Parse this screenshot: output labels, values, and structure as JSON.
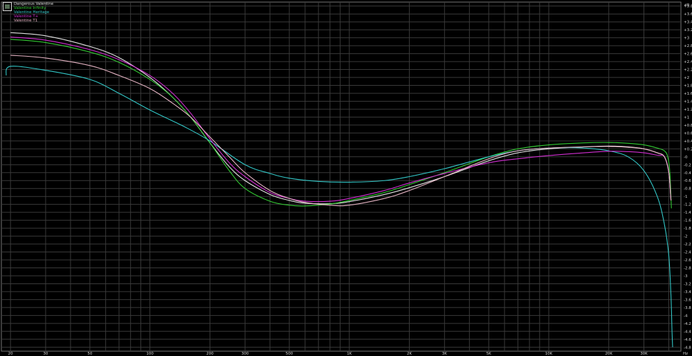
{
  "chart_data": {
    "type": "line",
    "title": "",
    "xlabel": "Hz",
    "ylabel": "dB",
    "x_scale": "log",
    "xlim": [
      18,
      46000
    ],
    "ylim": [
      -4.9,
      3.9
    ],
    "grid": true,
    "legend_position": "top-left",
    "x_tick_labels": [
      {
        "value": 20,
        "label": "20"
      },
      {
        "value": 30,
        "label": "30"
      },
      {
        "value": 50,
        "label": "50"
      },
      {
        "value": 100,
        "label": "100"
      },
      {
        "value": 200,
        "label": "200"
      },
      {
        "value": 300,
        "label": "300"
      },
      {
        "value": 500,
        "label": "500"
      },
      {
        "value": 1000,
        "label": "1K"
      },
      {
        "value": 2000,
        "label": "2K"
      },
      {
        "value": 3000,
        "label": "3K"
      },
      {
        "value": 5000,
        "label": "5K"
      },
      {
        "value": 10000,
        "label": "10K"
      },
      {
        "value": 20000,
        "label": "20K"
      },
      {
        "value": 30000,
        "label": "30K"
      }
    ],
    "y_tick_labels": [
      {
        "value": 3.8,
        "label": "+3.8"
      },
      {
        "value": 3.6,
        "label": "+3.6"
      },
      {
        "value": 3.4,
        "label": "+3.4"
      },
      {
        "value": 3.2,
        "label": "+3.2"
      },
      {
        "value": 3.0,
        "label": "+3"
      },
      {
        "value": 2.8,
        "label": "+2.8"
      },
      {
        "value": 2.6,
        "label": "+2.6"
      },
      {
        "value": 2.4,
        "label": "+2.4"
      },
      {
        "value": 2.2,
        "label": "+2.2"
      },
      {
        "value": 2.0,
        "label": "+2"
      },
      {
        "value": 1.8,
        "label": "+1.8"
      },
      {
        "value": 1.6,
        "label": "+1.6"
      },
      {
        "value": 1.4,
        "label": "+1.4"
      },
      {
        "value": 1.2,
        "label": "+1.2"
      },
      {
        "value": 1.0,
        "label": "+1"
      },
      {
        "value": 0.8,
        "label": "+0.8"
      },
      {
        "value": 0.6,
        "label": "+0.6"
      },
      {
        "value": 0.4,
        "label": "+0.4"
      },
      {
        "value": 0.2,
        "label": "+0.2"
      },
      {
        "value": 0.0,
        "label": "-0"
      },
      {
        "value": -0.2,
        "label": "-0.2"
      },
      {
        "value": -0.4,
        "label": "-0.4"
      },
      {
        "value": -0.6,
        "label": "-0.6"
      },
      {
        "value": -0.8,
        "label": "-0.8"
      },
      {
        "value": -1.0,
        "label": "-1"
      },
      {
        "value": -1.2,
        "label": "-1.2"
      },
      {
        "value": -1.4,
        "label": "-1.4"
      },
      {
        "value": -1.6,
        "label": "-1.6"
      },
      {
        "value": -1.8,
        "label": "-1.8"
      },
      {
        "value": -2.0,
        "label": "-2"
      },
      {
        "value": -2.2,
        "label": "-2.2"
      },
      {
        "value": -2.4,
        "label": "-2.4"
      },
      {
        "value": -2.6,
        "label": "-2.6"
      },
      {
        "value": -2.8,
        "label": "-2.8"
      },
      {
        "value": -3.0,
        "label": "-3"
      },
      {
        "value": -3.2,
        "label": "-3.2"
      },
      {
        "value": -3.4,
        "label": "-3.4"
      },
      {
        "value": -3.6,
        "label": "-3.6"
      },
      {
        "value": -3.8,
        "label": "-3.8"
      },
      {
        "value": -4.0,
        "label": "-4"
      },
      {
        "value": -4.2,
        "label": "-4.2"
      },
      {
        "value": -4.4,
        "label": "-4.4"
      },
      {
        "value": -4.6,
        "label": "-4.6"
      },
      {
        "value": -4.8,
        "label": "-4.8"
      }
    ],
    "series": [
      {
        "name": "Dangerous Valentine",
        "color": "#e6e6e6",
        "points": [
          [
            20,
            3.13
          ],
          [
            30,
            3.05
          ],
          [
            50,
            2.78
          ],
          [
            70,
            2.5
          ],
          [
            100,
            2.0
          ],
          [
            130,
            1.5
          ],
          [
            160,
            1.0
          ],
          [
            200,
            0.35
          ],
          [
            250,
            -0.25
          ],
          [
            300,
            -0.6
          ],
          [
            400,
            -0.95
          ],
          [
            500,
            -1.1
          ],
          [
            600,
            -1.17
          ],
          [
            800,
            -1.18
          ],
          [
            1000,
            -1.13
          ],
          [
            1500,
            -0.95
          ],
          [
            2000,
            -0.78
          ],
          [
            3000,
            -0.5
          ],
          [
            5000,
            -0.1
          ],
          [
            7000,
            0.1
          ],
          [
            10000,
            0.2
          ],
          [
            15000,
            0.25
          ],
          [
            20000,
            0.27
          ],
          [
            25000,
            0.25
          ],
          [
            30000,
            0.2
          ],
          [
            35000,
            0.1
          ],
          [
            38000,
            0.0
          ],
          [
            40000,
            -0.4
          ],
          [
            41000,
            -1.1
          ]
        ]
      },
      {
        "name": "Valentine Infinity",
        "color": "#33cc33",
        "points": [
          [
            20,
            2.96
          ],
          [
            30,
            2.88
          ],
          [
            50,
            2.64
          ],
          [
            70,
            2.38
          ],
          [
            100,
            1.95
          ],
          [
            130,
            1.5
          ],
          [
            160,
            1.0
          ],
          [
            200,
            0.35
          ],
          [
            250,
            -0.35
          ],
          [
            300,
            -0.8
          ],
          [
            400,
            -1.12
          ],
          [
            500,
            -1.22
          ],
          [
            600,
            -1.24
          ],
          [
            800,
            -1.19
          ],
          [
            1000,
            -1.1
          ],
          [
            1500,
            -0.9
          ],
          [
            2000,
            -0.7
          ],
          [
            3000,
            -0.4
          ],
          [
            5000,
            0.0
          ],
          [
            7000,
            0.2
          ],
          [
            10000,
            0.3
          ],
          [
            15000,
            0.35
          ],
          [
            20000,
            0.36
          ],
          [
            25000,
            0.34
          ],
          [
            30000,
            0.3
          ],
          [
            35000,
            0.22
          ],
          [
            38000,
            0.15
          ],
          [
            39500,
            0.0
          ],
          [
            40500,
            -0.4
          ],
          [
            41200,
            -1.3
          ]
        ]
      },
      {
        "name": "Valentine Heritage",
        "color": "#33c9c9",
        "points": [
          [
            19,
            2.05
          ],
          [
            20,
            2.28
          ],
          [
            30,
            2.18
          ],
          [
            50,
            1.95
          ],
          [
            70,
            1.6
          ],
          [
            100,
            1.18
          ],
          [
            150,
            0.75
          ],
          [
            200,
            0.4
          ],
          [
            300,
            -0.2
          ],
          [
            400,
            -0.42
          ],
          [
            500,
            -0.54
          ],
          [
            700,
            -0.62
          ],
          [
            1000,
            -0.64
          ],
          [
            1500,
            -0.6
          ],
          [
            2000,
            -0.5
          ],
          [
            3000,
            -0.3
          ],
          [
            5000,
            0.0
          ],
          [
            7000,
            0.15
          ],
          [
            10000,
            0.22
          ],
          [
            15000,
            0.22
          ],
          [
            20000,
            0.15
          ],
          [
            25000,
            0.0
          ],
          [
            30000,
            -0.35
          ],
          [
            35000,
            -1.0
          ],
          [
            38000,
            -1.7
          ],
          [
            40000,
            -2.5
          ],
          [
            41000,
            -3.5
          ],
          [
            41500,
            -4.4
          ],
          [
            41800,
            -4.8
          ]
        ]
      },
      {
        "name": "Valentine T+",
        "color": "#d42fd4",
        "points": [
          [
            20,
            3.02
          ],
          [
            30,
            2.94
          ],
          [
            50,
            2.7
          ],
          [
            70,
            2.45
          ],
          [
            100,
            2.05
          ],
          [
            130,
            1.6
          ],
          [
            160,
            1.1
          ],
          [
            200,
            0.45
          ],
          [
            250,
            -0.15
          ],
          [
            300,
            -0.5
          ],
          [
            400,
            -0.9
          ],
          [
            500,
            -1.05
          ],
          [
            600,
            -1.12
          ],
          [
            800,
            -1.12
          ],
          [
            1000,
            -1.05
          ],
          [
            1500,
            -0.85
          ],
          [
            2000,
            -0.66
          ],
          [
            3000,
            -0.42
          ],
          [
            5000,
            -0.15
          ],
          [
            7000,
            -0.05
          ],
          [
            10000,
            0.03
          ],
          [
            15000,
            0.1
          ],
          [
            20000,
            0.14
          ],
          [
            25000,
            0.13
          ],
          [
            30000,
            0.1
          ],
          [
            35000,
            0.04
          ],
          [
            38000,
            0.0
          ],
          [
            40000,
            -0.4
          ],
          [
            41000,
            -1.1
          ]
        ]
      },
      {
        "name": "Valentine T1",
        "color": "#e7b5c5",
        "points": [
          [
            20,
            2.56
          ],
          [
            30,
            2.49
          ],
          [
            50,
            2.3
          ],
          [
            70,
            2.05
          ],
          [
            100,
            1.72
          ],
          [
            130,
            1.35
          ],
          [
            160,
            1.0
          ],
          [
            200,
            0.5
          ],
          [
            250,
            0.0
          ],
          [
            300,
            -0.4
          ],
          [
            400,
            -0.85
          ],
          [
            500,
            -1.05
          ],
          [
            600,
            -1.15
          ],
          [
            800,
            -1.22
          ],
          [
            1000,
            -1.22
          ],
          [
            1500,
            -1.05
          ],
          [
            2000,
            -0.85
          ],
          [
            3000,
            -0.5
          ],
          [
            5000,
            -0.05
          ],
          [
            7000,
            0.15
          ],
          [
            10000,
            0.22
          ],
          [
            15000,
            0.25
          ],
          [
            20000,
            0.26
          ],
          [
            25000,
            0.24
          ],
          [
            30000,
            0.2
          ],
          [
            35000,
            0.1
          ],
          [
            38000,
            0.0
          ],
          [
            40000,
            -0.4
          ],
          [
            41000,
            -1.1
          ]
        ]
      }
    ]
  }
}
